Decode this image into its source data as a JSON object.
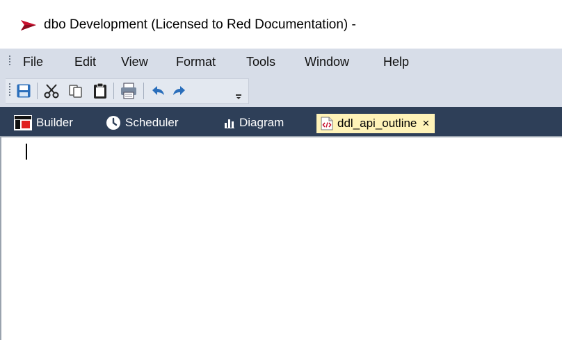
{
  "window": {
    "title": "dbo  Development  (Licensed to Red Documentation) -",
    "app_icon": "red-arrow-logo-icon"
  },
  "menubar": {
    "items": [
      "File",
      "Edit",
      "View",
      "Format",
      "Tools",
      "Window",
      "Help"
    ]
  },
  "toolbar": {
    "buttons": [
      "save-icon",
      "cut-icon",
      "copy-icon",
      "paste-icon",
      "print-icon",
      "undo-icon",
      "redo-icon",
      "toolbar-options-icon"
    ]
  },
  "tabs": [
    {
      "label": "Builder",
      "icon": "builder-icon",
      "active": false
    },
    {
      "label": "Scheduler",
      "icon": "clock-icon",
      "active": false
    },
    {
      "label": "Diagram",
      "icon": "diagram-icon",
      "active": false
    },
    {
      "label": "ddl_api_outline",
      "icon": "code-file-icon",
      "active": true,
      "close_glyph": "×"
    }
  ],
  "editor": {
    "content": ""
  },
  "colors": {
    "menubar_bg": "#d7dde8",
    "tabstrip_bg": "#2e3f58",
    "active_tab_bg": "#fff3b8",
    "accent_blue": "#2a6ebb",
    "brand_red": "#c8102e"
  }
}
